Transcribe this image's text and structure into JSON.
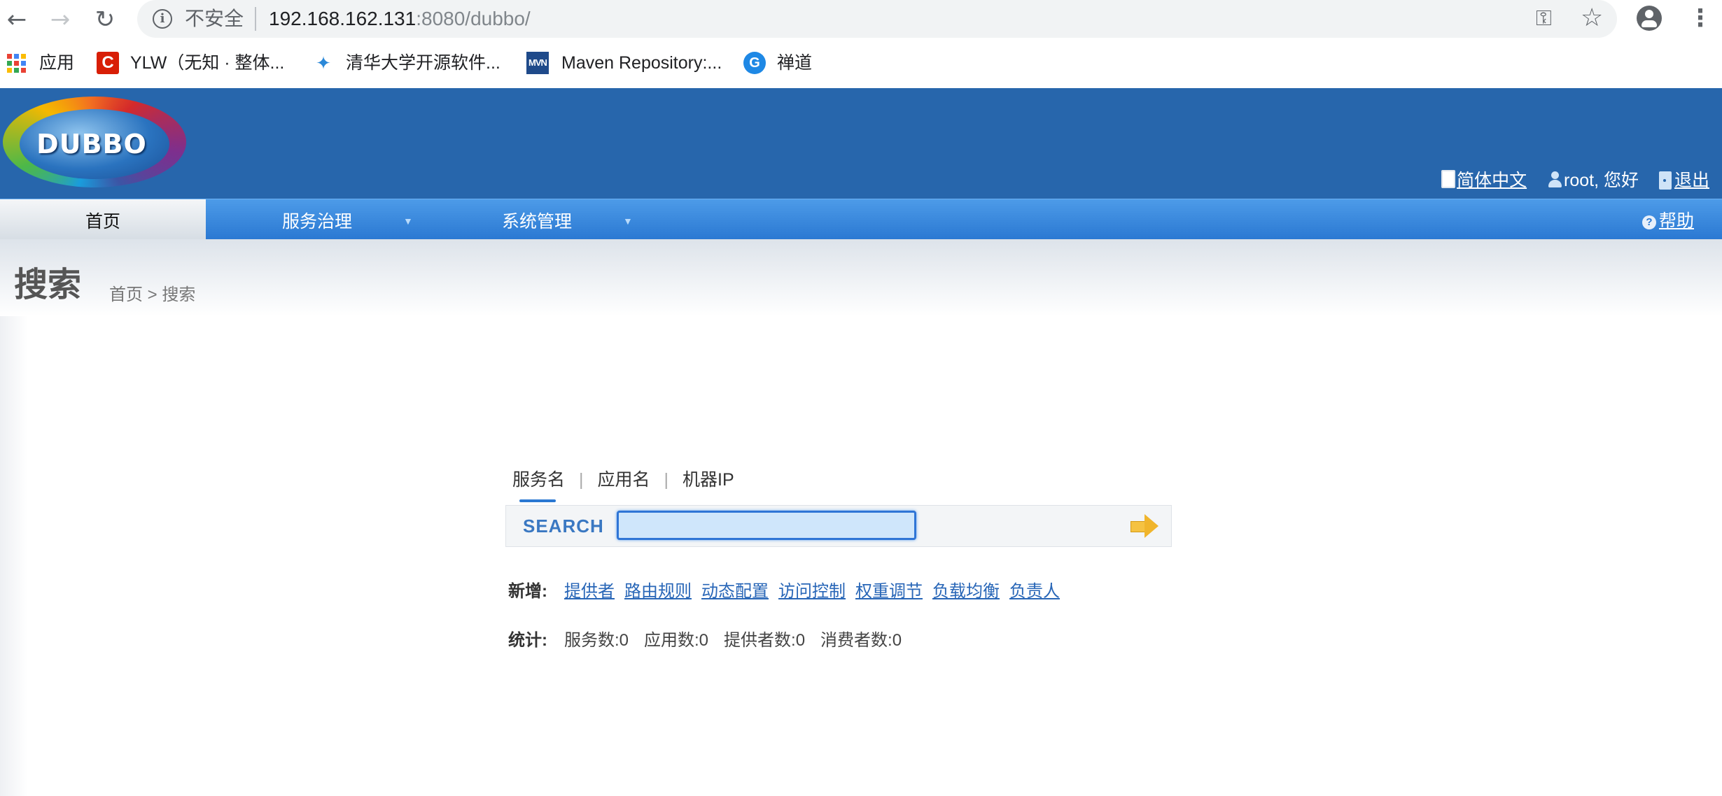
{
  "browser": {
    "insecure_label": "不安全",
    "url_host": "192.168.162.131",
    "url_rest": ":8080/dubbo/",
    "bookmarks": [
      {
        "label": "应用",
        "icon": "apps-grid-icon"
      },
      {
        "label": "YLW（无知 · 整体...",
        "icon": "ylw-icon"
      },
      {
        "label": "清华大学开源软件...",
        "icon": "tsinghua-icon"
      },
      {
        "label": "Maven Repository:...",
        "icon": "mvn-icon"
      },
      {
        "label": "禅道",
        "icon": "zentao-icon"
      }
    ]
  },
  "header": {
    "logo_text": "DUBBO",
    "lang_link": "简体中文",
    "user_greeting": "root, 您好",
    "logout_link": "退出"
  },
  "nav": {
    "home": "首页",
    "service_governance": "服务治理",
    "system_management": "系统管理",
    "help": "帮助"
  },
  "page": {
    "title": "搜索",
    "breadcrumb": "首页 > 搜索"
  },
  "search": {
    "tabs": [
      "服务名",
      "应用名",
      "机器IP"
    ],
    "label": "SEARCH",
    "value": ""
  },
  "add_row": {
    "label": "新增:",
    "links": [
      "提供者",
      "路由规则",
      "动态配置",
      "访问控制",
      "权重调节",
      "负载均衡",
      "负责人"
    ]
  },
  "stats": {
    "label": "统计:",
    "items": [
      "服务数:0",
      "应用数:0",
      "提供者数:0",
      "消费者数:0"
    ]
  },
  "colors": {
    "header_blue": "#2766ac",
    "nav_blue": "#2a78d2",
    "link_blue": "#2866b7"
  }
}
